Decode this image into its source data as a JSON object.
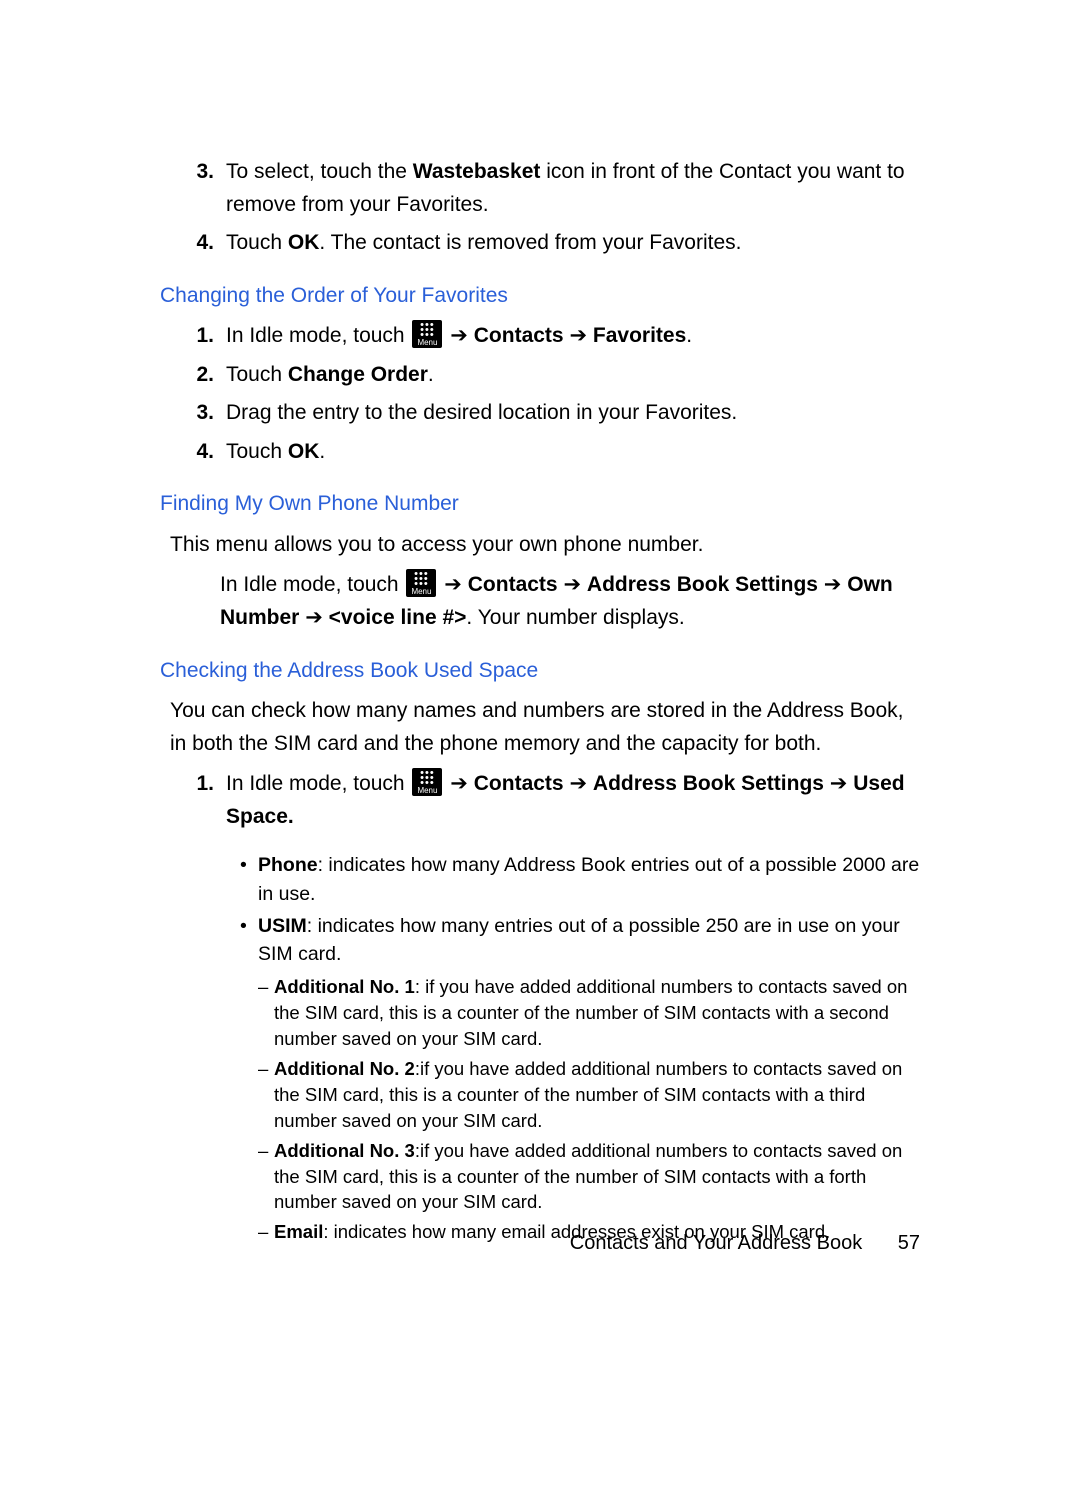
{
  "labels": {
    "menu": "Menu",
    "arrow": "➔"
  },
  "intro": {
    "steps": [
      {
        "num": "3.",
        "prefix": "To select, touch the ",
        "bold1": "Wastebasket",
        "suffix": " icon in front of the Contact you want to remove from your Favorites."
      },
      {
        "num": "4.",
        "prefix": "Touch ",
        "bold1": "OK",
        "suffix": ". The contact is removed from your Favorites."
      }
    ]
  },
  "section1": {
    "heading": "Changing the Order of Your Favorites",
    "steps": [
      {
        "num": "1.",
        "prefix": "In Idle mode, touch ",
        "icon": true,
        "linkA": "Contacts",
        "linkB": "Favorites",
        "suffix": "."
      },
      {
        "num": "2.",
        "prefix": "Touch ",
        "bold1": "Change Order",
        "suffix": "."
      },
      {
        "num": "3.",
        "prefix": "Drag the entry to the desired location in your Favorites."
      },
      {
        "num": "4.",
        "prefix": "Touch ",
        "bold1": "OK",
        "suffix": "."
      }
    ]
  },
  "section2": {
    "heading": "Finding My Own Phone Number",
    "para": "This menu allows you to access your own phone number.",
    "step": {
      "prefix": "In Idle mode, touch ",
      "arrow": "➔",
      "linkA": "Contacts",
      "linkB": "Address Book Settings",
      "linkC": "Own Number",
      "linkD": "<voice line #>",
      "suffix": ". Your number displays."
    }
  },
  "section3": {
    "heading": "Checking the Address Book Used Space",
    "para": "You can check how many names and numbers are stored in the Address Book, in both the SIM card and the phone memory and the capacity for both.",
    "step": {
      "num": "1.",
      "prefix": "In Idle mode, touch ",
      "arrow": "➔",
      "linkA": "Contacts",
      "linkB": "Address Book Settings",
      "linkC": "Used Space."
    },
    "bullets": [
      {
        "bold": "Phone",
        "text": ": indicates how many Address Book entries out of a possible 2000 are in use."
      },
      {
        "bold": "USIM",
        "text": ": indicates how many entries out of a possible 250 are in use on your SIM card."
      }
    ],
    "dashes": [
      {
        "bold": "Additional No. 1",
        "text": ": if you have added additional numbers to contacts saved on the SIM card, this is a counter of the number of SIM contacts with a second number saved on your SIM card."
      },
      {
        "bold": "Additional No. 2",
        "text": ":if you have added additional numbers to contacts saved on the SIM card, this is a counter of the number of SIM contacts with a third number saved on your SIM card."
      },
      {
        "bold": "Additional No. 3",
        "text": ":if you have added additional numbers to contacts saved on the SIM card, this is a counter of the number of SIM contacts with a forth number saved on your SIM card."
      },
      {
        "bold": "Email",
        "text": ": indicates how many email addresses exist on your SIM card."
      }
    ]
  },
  "footer": {
    "title": "Contacts and Your Address Book",
    "page": "57"
  }
}
